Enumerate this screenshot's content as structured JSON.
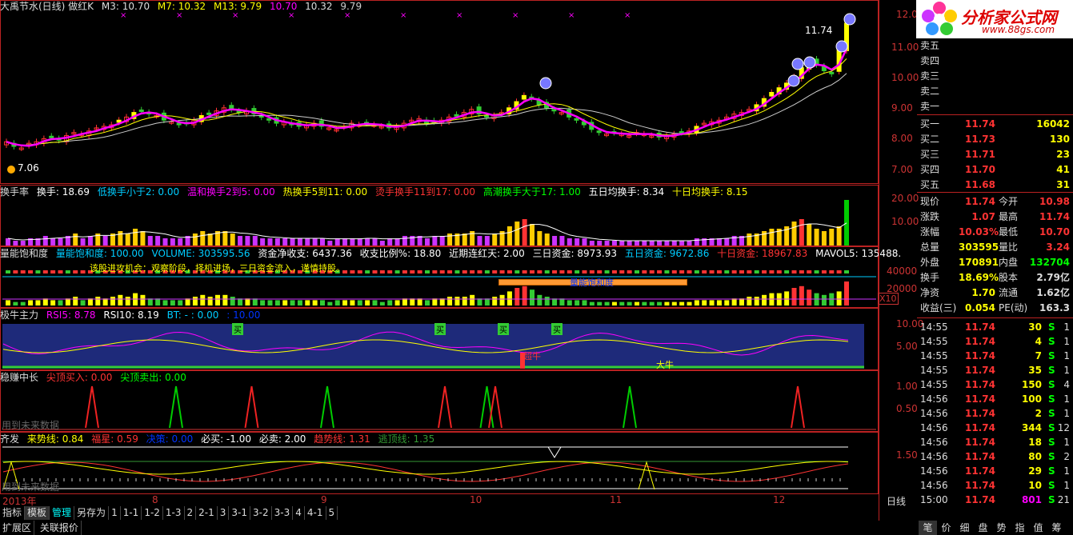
{
  "main": {
    "title": "大禹节水(日线) 做红K",
    "ma3": "M3: 10.70",
    "ma7": "M7: 10.32",
    "ma13": "M13: 9.79",
    "v1": "10.70",
    "v2": "10.32",
    "v3": "9.79",
    "high_label": "11.74",
    "low_label": "7.06"
  },
  "main_yticks": [
    "12.0",
    "11.00",
    "10.00",
    "9.00",
    "8.00",
    "7.00"
  ],
  "turnover": {
    "title": "换手率",
    "t1": "换手: 18.69",
    "t2": "低换手小于2: 0.00",
    "t3": "温和换手2到5: 0.00",
    "t4": "热换手5到11: 0.00",
    "t5": "烫手换手11到17: 0.00",
    "t6": "高潮换手大于17: 1.00",
    "t7": "五日均换手: 8.34",
    "t8": "十日均换手: 8.15"
  },
  "turnover_yticks": [
    "20.00",
    "10.00"
  ],
  "volsat": {
    "title": "量能饱和度",
    "t1": "量能饱和度: 100.00",
    "t2": "VOLUME: 303595.56",
    "t3": "资金净收支: 6437.36",
    "t4": "收支比例%: 18.80",
    "t5": "近期连红天: 2.00",
    "t6": "三日资金: 8973.93",
    "t7": "五日资金: 9672.86",
    "t8": "十日资金: 18967.83",
    "t9": "MAVOL5: 135488.",
    "note": "该股进攻机会：观察阶段，择机进场，三日资金流入，谨慎持股。",
    "box": "量能饱和度",
    "x10": "X10"
  },
  "volsat_yticks": [
    "40000",
    "20000"
  ],
  "niu": {
    "title": "极牛主力",
    "t1": "RSI5: 8.78",
    "t2": "RSI10: 8.19",
    "t3": "BT: - : 0.00",
    "t4": ": 10.00",
    "buy": "买",
    "bull": "超牛",
    "bigbull": "大牛"
  },
  "niu_yticks": [
    "10.00",
    "5.00"
  ],
  "wz": {
    "title": "稳赚中长",
    "t1": "尖顶买入: 0.00",
    "t2": "尖顶卖出: 0.00",
    "future": "用到未来数据"
  },
  "wz_yticks": [
    "1.00",
    "0.50"
  ],
  "qf": {
    "title": "齐发",
    "t1": "来势线: 0.84",
    "t2": "福星: 0.59",
    "t3": "决策: 0.00",
    "t4": "必买: -1.00",
    "t5": "必卖: 2.00",
    "t6": "趋势线: 1.31",
    "t7": "逃顶线: 1.35",
    "future": "用到未来数据"
  },
  "qf_yticks": [
    "1.50"
  ],
  "xaxis": {
    "year": "2013年",
    "labels": [
      "8",
      "9",
      "10",
      "11",
      "12"
    ],
    "period": "日线"
  },
  "tabs": [
    "指标",
    "模板",
    "管理",
    "另存为",
    "1",
    "1-1",
    "1-2",
    "1-3",
    "2",
    "2-1",
    "3",
    "3-1",
    "3-2",
    "3-3",
    "4",
    "4-1",
    "5"
  ],
  "foot": [
    "扩展区",
    "关联报价"
  ],
  "rtabs": [
    "笔",
    "价",
    "细",
    "盘",
    "势",
    "指",
    "值",
    "筹"
  ],
  "logo": {
    "text": "分析家公式网",
    "url": "www.88gs.com"
  },
  "order_book": {
    "sells": [
      {
        "label": "卖五"
      },
      {
        "label": "卖四"
      },
      {
        "label": "卖三"
      },
      {
        "label": "卖二"
      },
      {
        "label": "卖一"
      }
    ],
    "buys": [
      {
        "label": "买一",
        "price": "11.74",
        "vol": "16042"
      },
      {
        "label": "买二",
        "price": "11.73",
        "vol": "130"
      },
      {
        "label": "买三",
        "price": "11.71",
        "vol": "23"
      },
      {
        "label": "买四",
        "price": "11.70",
        "vol": "41"
      },
      {
        "label": "买五",
        "price": "11.68",
        "vol": "31"
      }
    ]
  },
  "quote": [
    {
      "l1": "现价",
      "v1": "11.74",
      "l2": "今开",
      "v2": "10.98"
    },
    {
      "l1": "涨跌",
      "v1": "1.07",
      "l2": "最高",
      "v2": "11.74"
    },
    {
      "l1": "涨幅",
      "v1": "10.03%",
      "l2": "最低",
      "v2": "10.70"
    },
    {
      "l1": "总量",
      "v1": "303595",
      "l2": "量比",
      "v2": "3.24"
    },
    {
      "l1": "外盘",
      "v1": "170891",
      "l2": "内盘",
      "v2": "132704"
    },
    {
      "l1": "换手",
      "v1": "18.69%",
      "l2": "股本",
      "v2": "2.79亿"
    },
    {
      "l1": "净资",
      "v1": "1.70",
      "l2": "流通",
      "v2": "1.62亿"
    },
    {
      "l1": "收益(三)",
      "v1": "0.054",
      "l2": "PE(动)",
      "v2": "163.3"
    }
  ],
  "ticks": [
    {
      "t": "14:55",
      "p": "11.74",
      "v": "30",
      "s": "S",
      "n": "1"
    },
    {
      "t": "14:55",
      "p": "11.74",
      "v": "4",
      "s": "S",
      "n": "1"
    },
    {
      "t": "14:55",
      "p": "11.74",
      "v": "7",
      "s": "S",
      "n": "1"
    },
    {
      "t": "14:55",
      "p": "11.74",
      "v": "35",
      "s": "S",
      "n": "1"
    },
    {
      "t": "14:55",
      "p": "11.74",
      "v": "150",
      "s": "S",
      "n": "4"
    },
    {
      "t": "14:56",
      "p": "11.74",
      "v": "100",
      "s": "S",
      "n": "1"
    },
    {
      "t": "14:56",
      "p": "11.74",
      "v": "2",
      "s": "S",
      "n": "1"
    },
    {
      "t": "14:56",
      "p": "11.74",
      "v": "344",
      "s": "S",
      "n": "12"
    },
    {
      "t": "14:56",
      "p": "11.74",
      "v": "18",
      "s": "S",
      "n": "1"
    },
    {
      "t": "14:56",
      "p": "11.74",
      "v": "80",
      "s": "S",
      "n": "2"
    },
    {
      "t": "14:56",
      "p": "11.74",
      "v": "29",
      "s": "S",
      "n": "1"
    },
    {
      "t": "14:56",
      "p": "11.74",
      "v": "10",
      "s": "S",
      "n": "1"
    },
    {
      "t": "15:00",
      "p": "11.74",
      "v": "801",
      "s": "S",
      "n": "21"
    }
  ],
  "closes": [
    7.9,
    7.75,
    7.7,
    7.85,
    7.9,
    8.0,
    8.05,
    7.95,
    8.1,
    8.2,
    8.15,
    8.25,
    8.35,
    8.4,
    8.45,
    8.6,
    8.7,
    8.85,
    8.9,
    8.8,
    8.75,
    8.6,
    8.55,
    8.45,
    8.5,
    8.6,
    8.75,
    8.8,
    8.9,
    9.0,
    8.95,
    8.85,
    8.9,
    8.8,
    8.7,
    8.6,
    8.5,
    8.55,
    8.45,
    8.4,
    8.45,
    8.5,
    8.4,
    8.35,
    8.3,
    8.4,
    8.5,
    8.45,
    8.5,
    8.45,
    8.4,
    8.35,
    8.4,
    8.5,
    8.6,
    8.65,
    8.5,
    8.55,
    8.6,
    8.7,
    8.75,
    8.85,
    8.95,
    8.8,
    8.7,
    8.75,
    8.85,
    9.0,
    9.2,
    9.4,
    9.3,
    9.1,
    9.0,
    8.9,
    8.85,
    8.7,
    8.6,
    8.45,
    8.3,
    8.2,
    8.15,
    8.2,
    8.15,
    8.1,
    8.2,
    8.15,
    8.1,
    8.05,
    8.1,
    8.15,
    8.2,
    8.25,
    8.4,
    8.5,
    8.55,
    8.6,
    8.7,
    8.8,
    8.85,
    8.95,
    9.1,
    9.3,
    9.5,
    9.65,
    9.8,
    10.0,
    10.3,
    10.5,
    10.4,
    10.2,
    10.1,
    10.9,
    11.74
  ],
  "turns": [
    3,
    2,
    2,
    3,
    3,
    4,
    3,
    3,
    4,
    5,
    3,
    4,
    5,
    4,
    5,
    6,
    5,
    7,
    6,
    4,
    4,
    3,
    3,
    3,
    4,
    5,
    6,
    5,
    6,
    6,
    5,
    4,
    4,
    4,
    3,
    3,
    3,
    3,
    3,
    3,
    3,
    3,
    3,
    2,
    3,
    3,
    3,
    3,
    3,
    3,
    2,
    3,
    3,
    4,
    4,
    4,
    3,
    4,
    4,
    5,
    5,
    5,
    6,
    4,
    4,
    5,
    6,
    8,
    10,
    11,
    9,
    6,
    5,
    4,
    4,
    3,
    3,
    3,
    2,
    2,
    2,
    2,
    2,
    2,
    2,
    2,
    2,
    2,
    2,
    2,
    2,
    2,
    3,
    3,
    3,
    3,
    3,
    4,
    4,
    5,
    5,
    6,
    7,
    7,
    8,
    10,
    11,
    9,
    7,
    6,
    7,
    8,
    19
  ],
  "wz_peaks": [
    0.2,
    0.38,
    0.57,
    0.74
  ],
  "wz_red": [
    0.1,
    0.52,
    0.29,
    0.58,
    0.94
  ]
}
